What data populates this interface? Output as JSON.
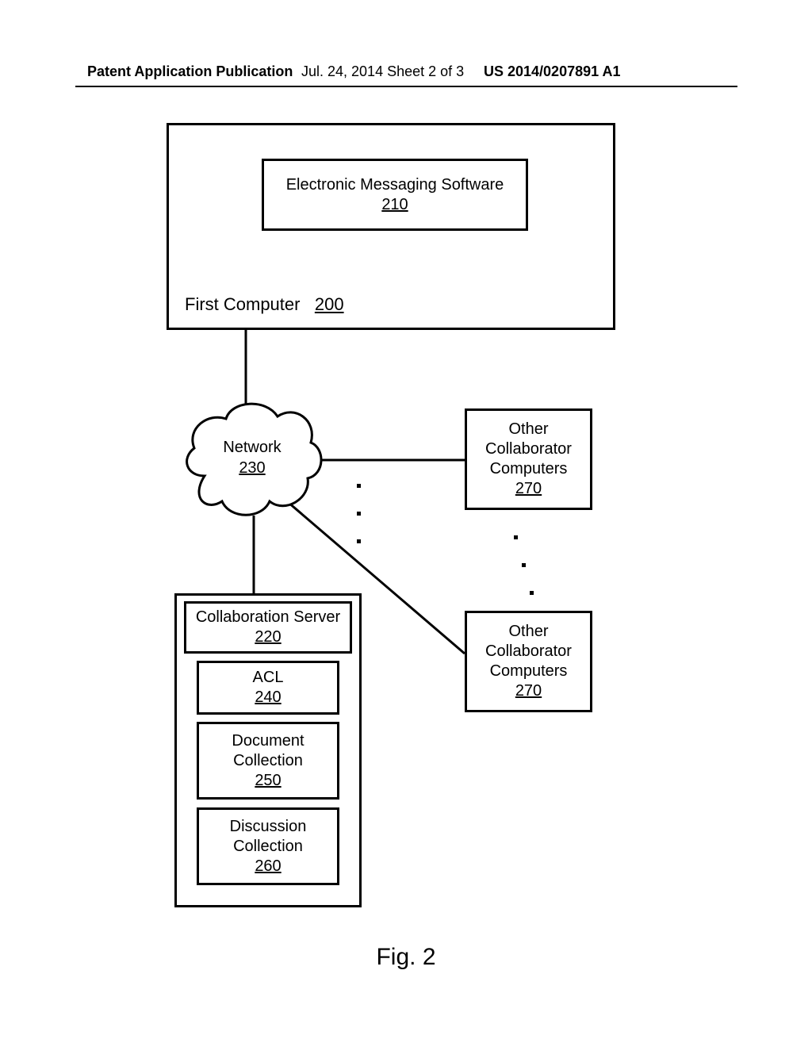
{
  "header": {
    "left": "Patent Application Publication",
    "mid": "Jul. 24, 2014  Sheet 2 of 3",
    "right": "US 2014/0207891 A1"
  },
  "diagram": {
    "first_computer": {
      "label": "First Computer",
      "ref": "200"
    },
    "messaging": {
      "label": "Electronic Messaging Software",
      "ref": "210"
    },
    "network": {
      "label": "Network",
      "ref": "230"
    },
    "server_box": {
      "collab_server": {
        "label": "Collaboration Server",
        "ref": "220"
      },
      "acl": {
        "label": "ACL",
        "ref": "240"
      },
      "doc_coll": {
        "label": "Document\nCollection",
        "ref": "250"
      },
      "disc_coll": {
        "label": "Discussion\nCollection",
        "ref": "260"
      }
    },
    "other_top": {
      "label": "Other\nCollaborator\nComputers",
      "ref": "270"
    },
    "other_bottom": {
      "label": "Other\nCollaborator\nComputers",
      "ref": "270"
    }
  },
  "figure_caption": "Fig. 2"
}
